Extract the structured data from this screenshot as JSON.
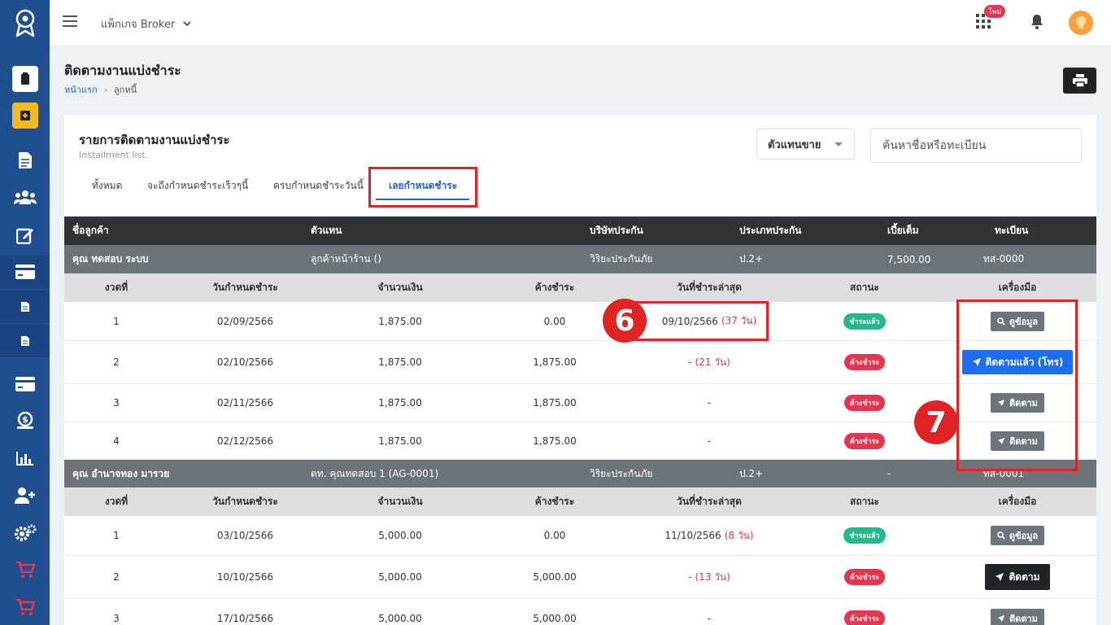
{
  "topbar": {
    "package_label": "แพ็กเกจ Broker",
    "new_badge": "ใหม่"
  },
  "page": {
    "title": "ติดตามงานแบ่งชำระ",
    "breadcrumb": [
      "หน้าแรก",
      "ลูกหนี้"
    ]
  },
  "card": {
    "title": "รายการติดตามงานแบ่งชำระ",
    "subtitle": "Installment list.",
    "agent_select": "ตัวแทนขาย",
    "search_placeholder": "ค้นหาชื่อหรือทะเบียน",
    "tabs": [
      {
        "label": "ทั้งหมด",
        "active": false
      },
      {
        "label": "จะถึงกำหนดชำระเร็วๆนี้",
        "active": false
      },
      {
        "label": "ครบกำหนดชำระวันนี้",
        "active": false
      },
      {
        "label": "เลยกำหนดชำระ",
        "active": true
      }
    ]
  },
  "table": {
    "columns": [
      "ชื่อลูกค้า",
      "ตัวแทน",
      "บริษัทประกัน",
      "ประเภทประกัน",
      "เบี้ยเต็ม",
      "ทะเบียน"
    ],
    "sub_columns": [
      "งวดที่",
      "วันกำหนดชำระ",
      "จำนวนเงิน",
      "ค้างชำระ",
      "วันที่ชำระล่าสุด",
      "สถานะ",
      "เครื่องมือ"
    ],
    "customers": [
      {
        "name": "คุณ ทดสอบ ระบบ",
        "agent": "ลูกค้าหน้าร้าน ()",
        "insurer": "วิริยะประกันภัย",
        "type": "ป.2+",
        "premium": "7,500.00",
        "plate": "ทส-0000",
        "installments": [
          {
            "no": "1",
            "due": "02/09/2566",
            "amount": "1,875.00",
            "outstanding": "0.00",
            "last_paid": "09/10/2566",
            "days": "(37 วัน)",
            "status": "ชำระแล้ว",
            "action": "ดูข้อมูล"
          },
          {
            "no": "2",
            "due": "02/10/2566",
            "amount": "1,875.00",
            "outstanding": "1,875.00",
            "last_paid": "-",
            "days": "(21 วัน)",
            "status": "ค้างชำระ",
            "action": "ติดตามแล้ว (โทร)"
          },
          {
            "no": "3",
            "due": "02/11/2566",
            "amount": "1,875.00",
            "outstanding": "1,875.00",
            "last_paid": "-",
            "days": "",
            "status": "ค้างชำระ",
            "action": "ติดตาม"
          },
          {
            "no": "4",
            "due": "02/12/2566",
            "amount": "1,875.00",
            "outstanding": "1,875.00",
            "last_paid": "-",
            "days": "",
            "status": "ค้างชำระ",
            "action": "ติดตาม"
          }
        ]
      },
      {
        "name": "คุณ อำนาจทอง มารวย",
        "agent": "ตท. คุณทดสอบ 1 (AG-0001)",
        "insurer": "วิริยะประกันภัย",
        "type": "ป.2+",
        "premium": "-",
        "plate": "ทส-0001",
        "installments": [
          {
            "no": "1",
            "due": "03/10/2566",
            "amount": "5,000.00",
            "outstanding": "0.00",
            "last_paid": "11/10/2566",
            "days": "(8 วัน)",
            "status": "ชำระแล้ว",
            "action": "ดูข้อมูล"
          },
          {
            "no": "2",
            "due": "10/10/2566",
            "amount": "5,000.00",
            "outstanding": "5,000.00",
            "last_paid": "-",
            "days": "(13 วัน)",
            "status": "ค้างชำระ",
            "action": "ติดตาม"
          },
          {
            "no": "3",
            "due": "17/10/2566",
            "amount": "5,000.00",
            "outstanding": "5,000.00",
            "last_paid": "-",
            "days": "",
            "status": "ค้างชำระ",
            "action": "ติดตาม"
          }
        ]
      }
    ]
  },
  "callouts": [
    "6",
    "7"
  ],
  "colors": {
    "sidebar": "#1f4e91",
    "accent_blue": "#1e63d1",
    "paid_badge": "#25b88d",
    "due_badge": "#e8344e",
    "highlight": "#e02424"
  }
}
